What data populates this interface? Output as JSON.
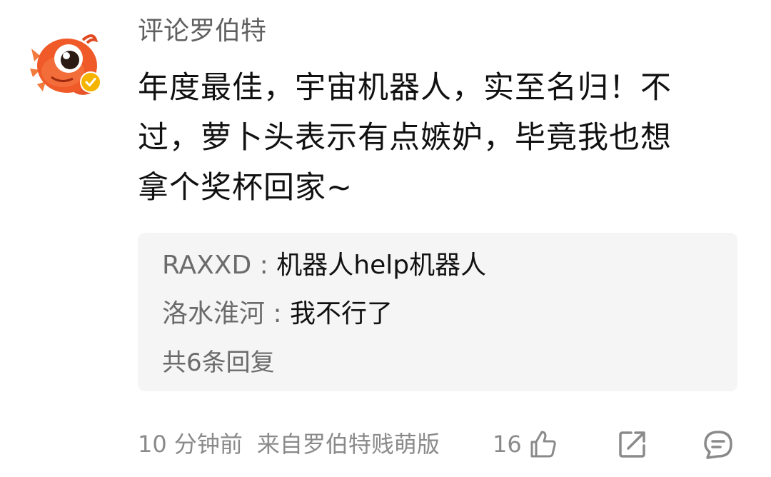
{
  "comment": {
    "username": "评论罗伯特",
    "content_lines": [
      "年度最佳，宇宙机器人，实至名归！不",
      "过，萝卜头表示有点嫉妒，毕竟我也想",
      "拿个奖杯回家~"
    ],
    "replies": [
      {
        "author": "RAXXD",
        "separator": " : ",
        "text": "机器人help机器人"
      },
      {
        "author": "洛水淮河",
        "separator": " : ",
        "text": "我不行了"
      }
    ],
    "more_replies": "共6条回复",
    "time": "10 分钟前",
    "source": "来自罗伯特贱萌版",
    "like_count": "16"
  },
  "icons": {
    "avatar": "robot-mascot-avatar",
    "badge": "verified-badge-icon",
    "like": "thumbs-up-icon",
    "share": "share-icon",
    "comment": "comment-icon"
  },
  "colors": {
    "avatar_primary": "#f05a28",
    "badge": "#f5b400",
    "reply_background": "#f5f5f5",
    "secondary_text": "#8a8a8a"
  }
}
